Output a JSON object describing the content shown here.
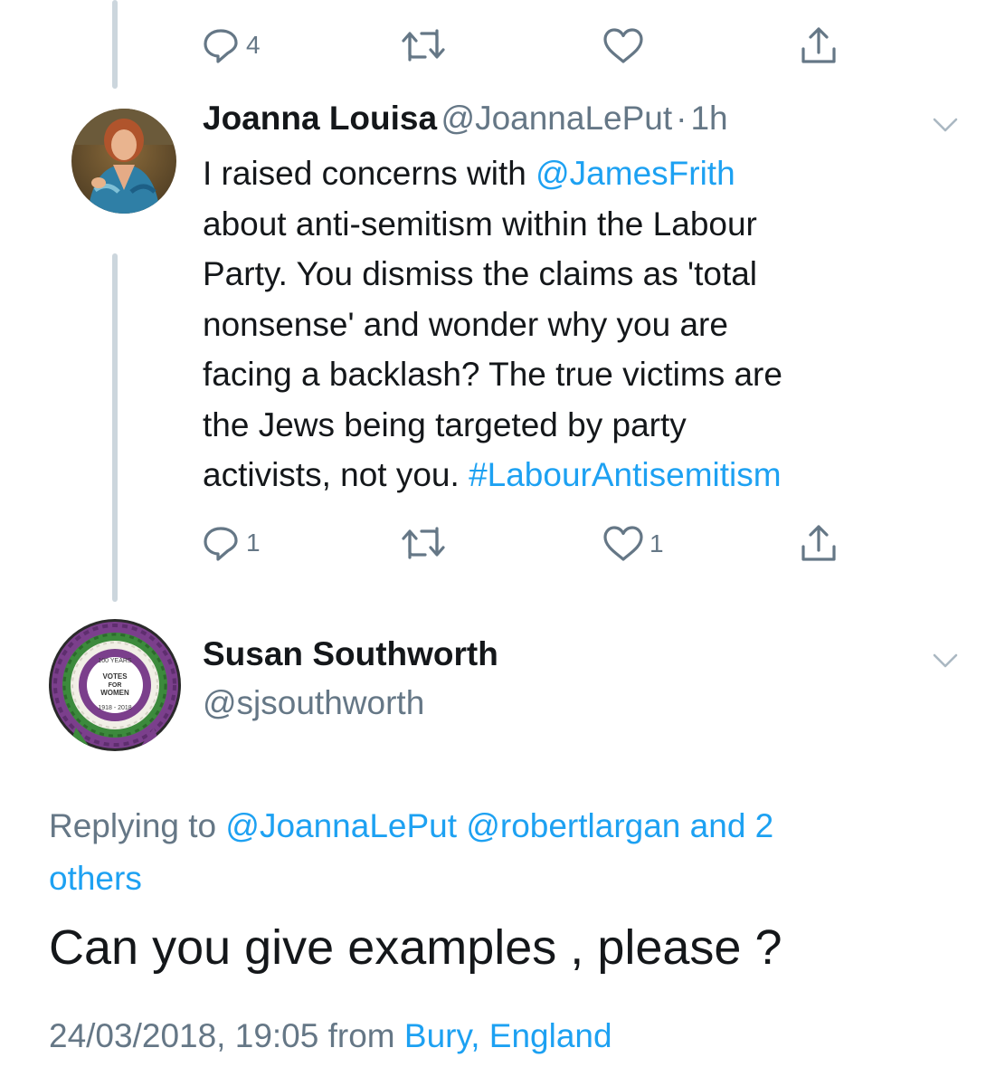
{
  "top_tweet": {
    "reply_count": "4",
    "retweet_count": "",
    "like_count": "",
    "icons": [
      "reply-icon",
      "retweet-icon",
      "like-icon",
      "share-icon"
    ]
  },
  "reply1": {
    "name": "Joanna Louisa",
    "handle": "@JoannaLePut",
    "separator": "·",
    "time": "1h",
    "text_lines": [
      {
        "pre": "I raised concerns with ",
        "link": "@JamesFrith",
        "post": ""
      },
      {
        "pre": "about anti-semitism within the Labour",
        "link": "",
        "post": ""
      },
      {
        "pre": "Party. You dismiss the claims as 'total",
        "link": "",
        "post": ""
      },
      {
        "pre": "nonsense' and wonder why you are",
        "link": "",
        "post": ""
      },
      {
        "pre": "facing a backlash? The true victims are",
        "link": "",
        "post": ""
      },
      {
        "pre": "the Jews being targeted by party",
        "link": "",
        "post": ""
      },
      {
        "pre": "activists, not you. ",
        "link": "#LabourAntisemitism",
        "post": ""
      }
    ],
    "reply_count": "1",
    "like_count": "1"
  },
  "reply2": {
    "name": "Susan Southworth",
    "handle": "@sjsouthworth",
    "rosette_text": {
      "arc_top": "100 YEARS",
      "line1": "VOTES",
      "line2": "FOR",
      "line3": "WOMEN",
      "arc_bottom": "1918 - 2018"
    },
    "replying_prefix": "Replying to ",
    "replying_handle1": "@JoannaLePut",
    "replying_handle2": "@robertlargan",
    "replying_and": "and 2",
    "replying_others": "others",
    "text": "Can you give examples , please ?",
    "timestamp": "24/03/2018, 19:05",
    "from_word": "from",
    "location": "Bury, England"
  },
  "colors": {
    "link": "#1da1f2",
    "secondary": "#657786",
    "primary_text": "#14171a",
    "thread_line": "#ccd6dd",
    "suffragette_purple": "#7b3f8c",
    "suffragette_green": "#3c8a3c"
  }
}
